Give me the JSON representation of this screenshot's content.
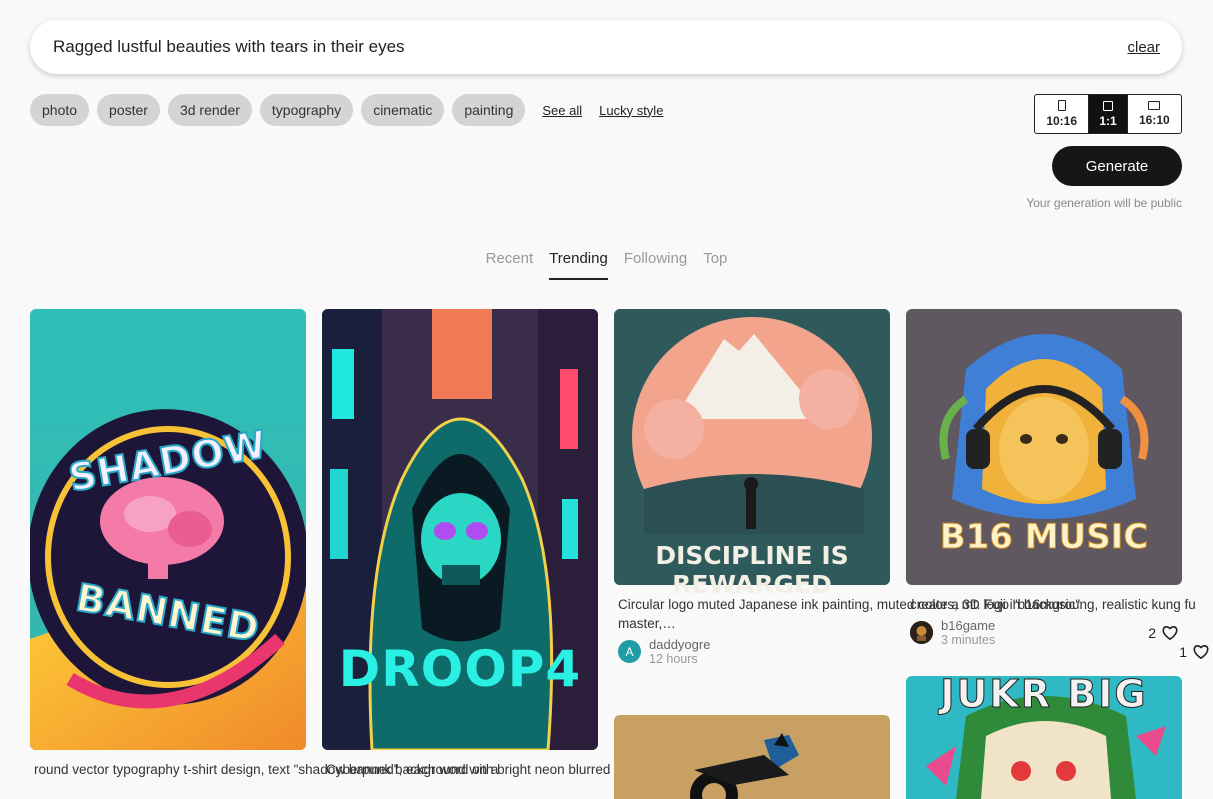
{
  "prompt": {
    "text": "Ragged lustful beauties with tears in their eyes",
    "clear_label": "clear"
  },
  "styles": {
    "chips": [
      "photo",
      "poster",
      "3d render",
      "typography",
      "cinematic",
      "painting"
    ],
    "see_all": "See all",
    "lucky": "Lucky style"
  },
  "ratios": [
    {
      "label": "10:16",
      "active": false
    },
    {
      "label": "1:1",
      "active": true
    },
    {
      "label": "16:10",
      "active": false
    }
  ],
  "generate": {
    "label": "Generate",
    "note": "Your generation will be public"
  },
  "tabs": [
    {
      "label": "Recent",
      "active": false
    },
    {
      "label": "Trending",
      "active": true
    },
    {
      "label": "Following",
      "active": false
    },
    {
      "label": "Top",
      "active": false
    }
  ],
  "cards": [
    {
      "image_text": [
        "SHADOW",
        "BANNED"
      ],
      "description": "round vector typography t-shirt design, text \"shadow banned\", each word on a"
    },
    {
      "image_text": [
        "DROOP4"
      ],
      "description": "Cyberpunk background with bright neon blurred focus. Portrait of grim reaper"
    },
    {
      "image_text": [
        "DISCIPLINE IS REWARGED"
      ],
      "description": "Circular logo muted Japanese ink painting, muted colors, mt. Fuji in backgroung, realistic kung fu master,…",
      "user": "daddyogre",
      "avatar_letter": "A",
      "time": "12 hours",
      "likes": "1"
    },
    {
      "image_text": [
        "B16 MUSIC"
      ],
      "description": "create a 3D logo \"b16music\"",
      "user": "b16game",
      "time": "3 minutes",
      "likes": "2"
    },
    {
      "image_text": []
    },
    {
      "image_text": [
        "JUKR BIG"
      ]
    }
  ],
  "colors": {
    "accent": "#161616",
    "chip_bg": "#d4d4d4",
    "avatar_teal": "#1f9ea5"
  }
}
